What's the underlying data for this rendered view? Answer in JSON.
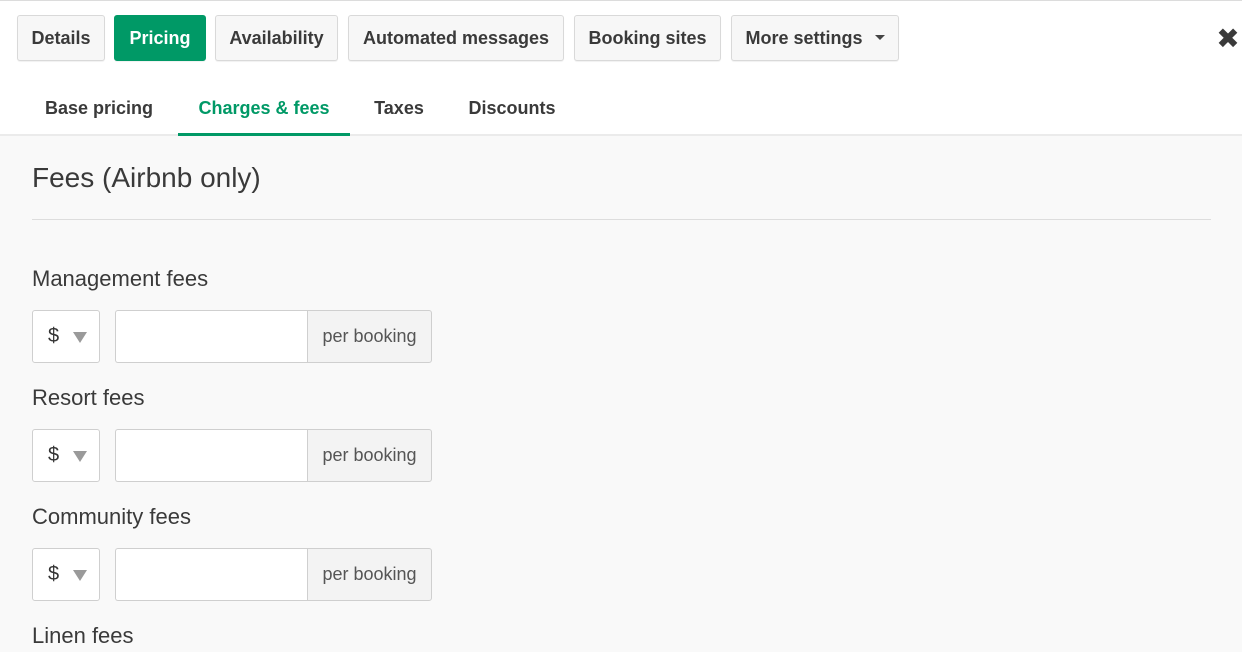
{
  "top_tabs": [
    {
      "label": "Details"
    },
    {
      "label": "Pricing"
    },
    {
      "label": "Availability"
    },
    {
      "label": "Automated messages"
    },
    {
      "label": "Booking sites"
    },
    {
      "label": "More settings"
    }
  ],
  "close_glyph": "✖",
  "sub_tabs": [
    {
      "label": "Base pricing"
    },
    {
      "label": "Charges & fees"
    },
    {
      "label": "Taxes"
    },
    {
      "label": "Discounts"
    }
  ],
  "section_title": "Fees (Airbnb only)",
  "fees": [
    {
      "label": "Management fees",
      "currency": "$",
      "value": "",
      "unit": "per booking"
    },
    {
      "label": "Resort fees",
      "currency": "$",
      "value": "",
      "unit": "per booking"
    },
    {
      "label": "Community fees",
      "currency": "$",
      "value": "",
      "unit": "per booking"
    },
    {
      "label": "Linen fees"
    }
  ],
  "colors": {
    "accent": "#009966",
    "background": "#f9f9f9",
    "border": "#cfcfcf"
  }
}
